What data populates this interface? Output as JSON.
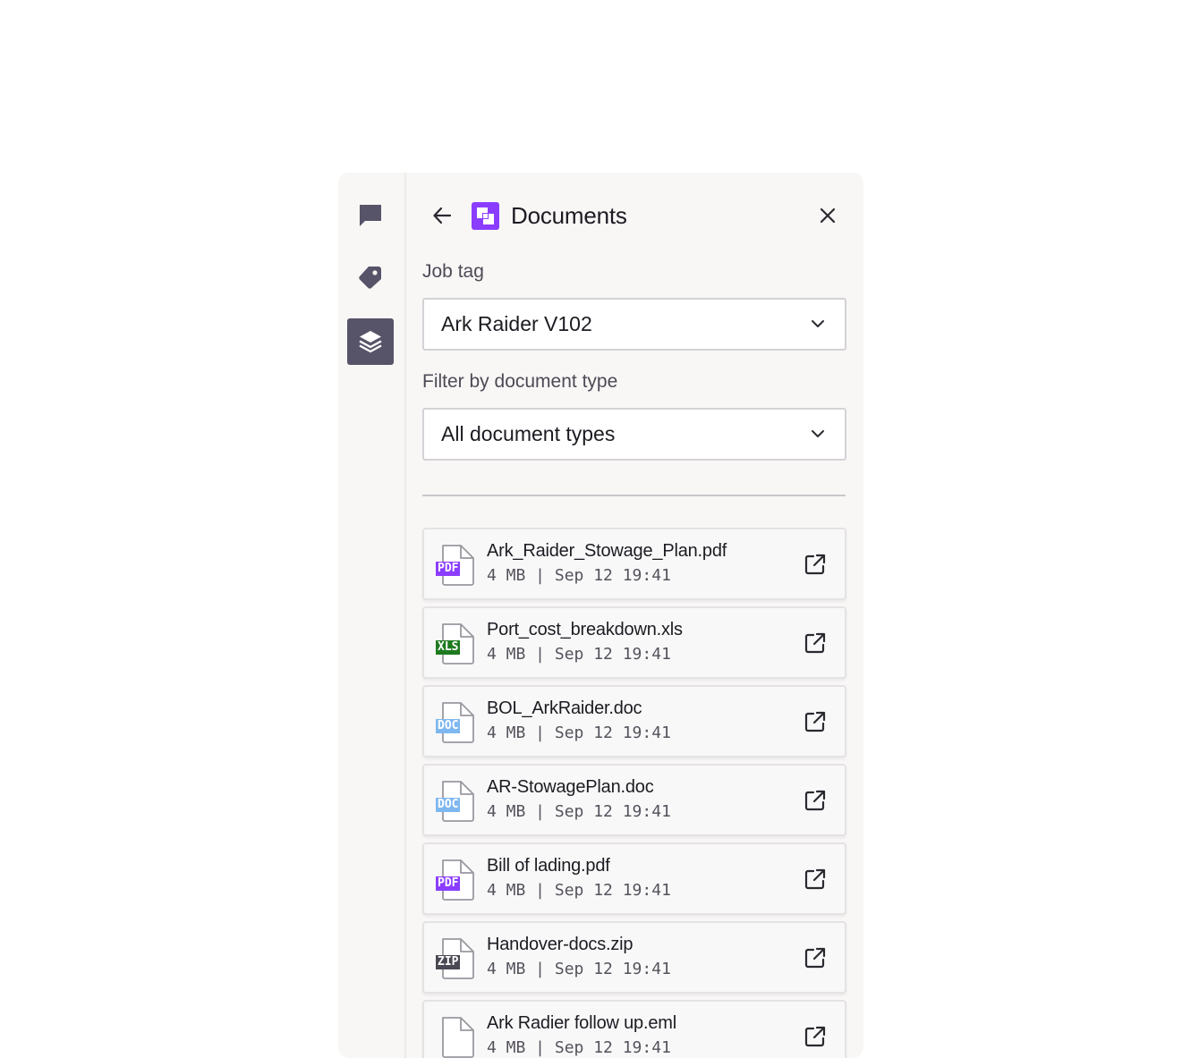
{
  "rail": {
    "items": [
      {
        "name": "chat-icon",
        "active": false
      },
      {
        "name": "tag-icon",
        "active": false
      },
      {
        "name": "layers-icon",
        "active": true
      }
    ]
  },
  "header": {
    "title": "Documents"
  },
  "job_tag": {
    "label": "Job tag",
    "value": "Ark Raider V102"
  },
  "doc_filter": {
    "label": "Filter by document type",
    "value": "All document types"
  },
  "files": [
    {
      "name": "Ark_Raider_Stowage_Plan.pdf",
      "meta": "4 MB | Sep 12 19:41",
      "type": "PDF",
      "badge_color": "#8b3dff"
    },
    {
      "name": "Port_cost_breakdown.xls",
      "meta": "4 MB | Sep 12 19:41",
      "type": "XLS",
      "badge_color": "#1f7a1f"
    },
    {
      "name": "BOL_ArkRaider.doc",
      "meta": "4 MB | Sep 12 19:41",
      "type": "DOC",
      "badge_color": "#7fb8f0"
    },
    {
      "name": "AR-StowagePlan.doc",
      "meta": "4 MB | Sep 12 19:41",
      "type": "DOC",
      "badge_color": "#7fb8f0"
    },
    {
      "name": "Bill of lading.pdf",
      "meta": "4 MB | Sep 12 19:41",
      "type": "PDF",
      "badge_color": "#8b3dff"
    },
    {
      "name": "Handover-docs.zip",
      "meta": "4 MB | Sep 12 19:41",
      "type": "ZIP",
      "badge_color": "#4a4852"
    },
    {
      "name": "Ark Radier follow up.eml",
      "meta": "4 MB | Sep 12 19:41",
      "type": "",
      "badge_color": "#4a4852"
    }
  ],
  "colors": {
    "accent": "#8b3dff",
    "rail_active": "#575368",
    "panel_bg": "#f8f7f6"
  }
}
